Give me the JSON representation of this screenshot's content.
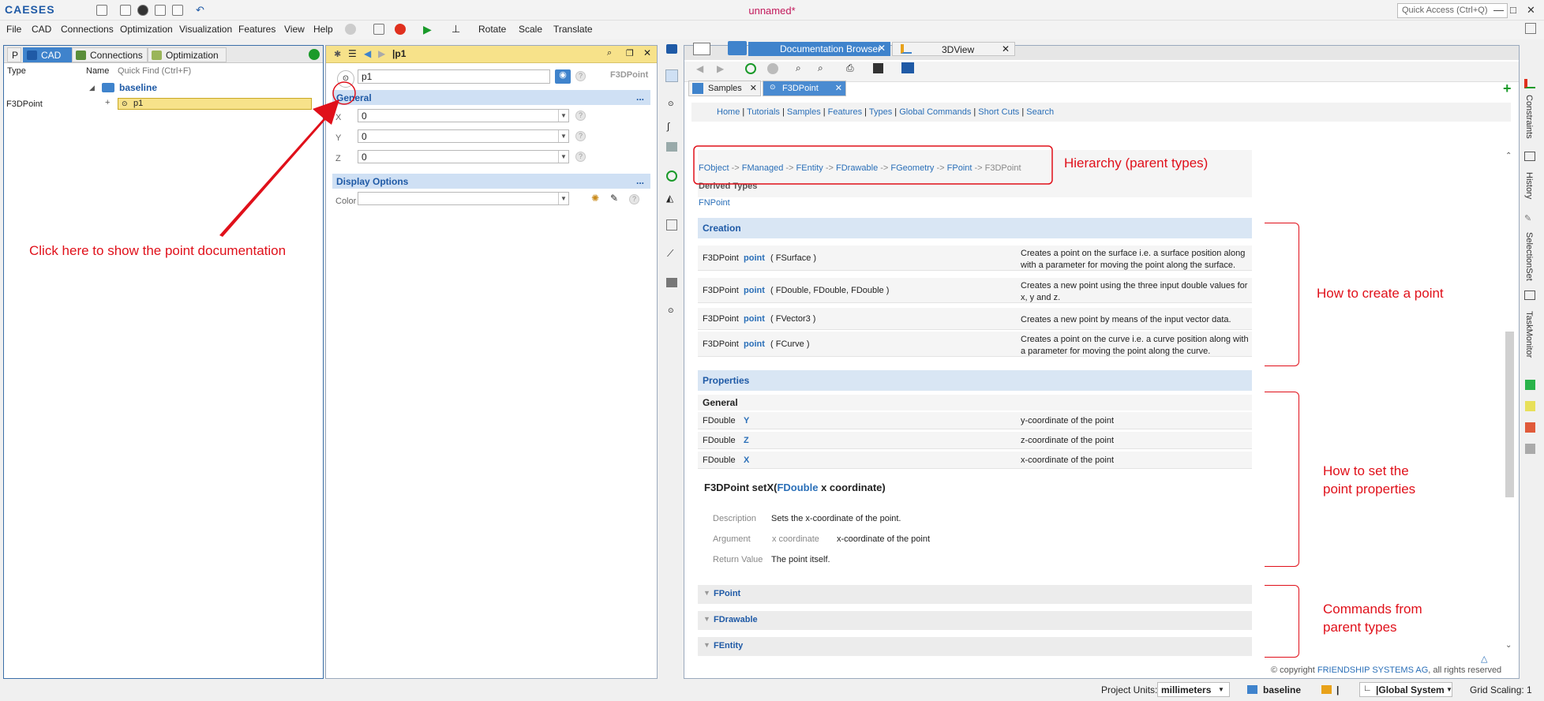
{
  "app": {
    "logo": "CAESES",
    "title": "unnamed*",
    "quick_access_placeholder": "Quick Access (Ctrl+Q)"
  },
  "menu": [
    "File",
    "CAD",
    "Connections",
    "Optimization",
    "Visualization",
    "Features",
    "View",
    "Help"
  ],
  "toolbar_actions": {
    "rotate": "Rotate",
    "scale": "Scale",
    "translate": "Translate"
  },
  "left": {
    "tabs": [
      {
        "label": "P"
      },
      {
        "label": "CAD"
      },
      {
        "label": "Connections"
      },
      {
        "label": "Optimization"
      }
    ],
    "col_type": "Type",
    "col_name": "Name",
    "quick_find": "Quick Find (Ctrl+F)",
    "tree": {
      "group": "baseline",
      "item_type": "F3DPoint",
      "item_name": "p1"
    }
  },
  "mid": {
    "header": "p1",
    "type_label": "F3DPoint",
    "name_value": "p1",
    "general": "General",
    "display": "Display Options",
    "fields": [
      {
        "label": "X",
        "value": "0"
      },
      {
        "label": "Y",
        "value": "0"
      },
      {
        "label": "Z",
        "value": "0"
      }
    ],
    "color_label": "Color",
    "more": "..."
  },
  "right": {
    "top_tabs": [
      {
        "label": "Documentation Browser"
      },
      {
        "label": "3DView"
      }
    ],
    "doc_tabs": [
      {
        "label": "Samples"
      },
      {
        "label": "F3DPoint"
      }
    ],
    "nav": [
      "Home",
      "Tutorials",
      "Samples",
      "Features",
      "Types",
      "Global Commands",
      "Short Cuts",
      "Search"
    ],
    "hierarchy": [
      "FObject",
      "FManaged",
      "FEntity",
      "FDrawable",
      "FGeometry",
      "FPoint"
    ],
    "hierarchy_current": "F3DPoint",
    "arrow": "->",
    "derived_title": "Derived Types",
    "derived": "FNPoint",
    "creation_title": "Creation",
    "creation": [
      {
        "type": "F3DPoint",
        "method": "point",
        "args": "( FSurface )",
        "desc": "Creates a point on the surface i.e. a surface position along with a parameter for moving the point along the surface."
      },
      {
        "type": "F3DPoint",
        "method": "point",
        "args": "( FDouble, FDouble, FDouble )",
        "desc": "Creates a new point using the three input double values for x, y and z."
      },
      {
        "type": "F3DPoint",
        "method": "point",
        "args": "( FVector3 )",
        "desc": "Creates a new point by means of the input vector data."
      },
      {
        "type": "F3DPoint",
        "method": "point",
        "args": "( FCurve )",
        "desc": "Creates a point on the curve i.e. a curve position along with a parameter for moving the point along the curve."
      }
    ],
    "properties_title": "Properties",
    "properties_sub": "General",
    "properties": [
      {
        "type": "FDouble",
        "name": "Y",
        "desc": "y-coordinate of the point"
      },
      {
        "type": "FDouble",
        "name": "Z",
        "desc": "z-coordinate of the point"
      },
      {
        "type": "FDouble",
        "name": "X",
        "desc": "x-coordinate of the point"
      }
    ],
    "setx": {
      "ret": "F3DPoint setX(",
      "argtype": "FDouble",
      "argname": " x coordinate)",
      "rows": [
        {
          "label": "Description",
          "value": "Sets the x-coordinate of the point.",
          "extra": ""
        },
        {
          "label": "Argument",
          "value": "x coordinate",
          "extra": "x-coordinate of the point"
        },
        {
          "label": "Return Value",
          "value": "The point itself.",
          "extra": ""
        }
      ]
    },
    "parents": [
      "FPoint",
      "FDrawable",
      "FEntity"
    ],
    "copyright": "© copyright",
    "copyright_org": "FRIENDSHIP SYSTEMS AG",
    "copyright_tail": ", all rights reserved"
  },
  "side_tabs": [
    "Constraints",
    "History",
    "SelectionSet",
    "TaskMonitor"
  ],
  "annotations": {
    "click": "Click here to show the point documentation",
    "hierarchy": "Hierarchy (parent types)",
    "create": "How to create a point",
    "set": [
      "How to set the",
      "point properties"
    ],
    "commands": [
      "Commands from",
      "parent types"
    ]
  },
  "status": {
    "units_label": "Project Units:",
    "units": "millimeters",
    "baseline": "baseline",
    "sep": "|",
    "system": "|Global System",
    "grid": "Grid Scaling: 1"
  },
  "colors": {
    "accent": "#3f83cc",
    "annot": "#e0101a",
    "highlight": "#f7e28a"
  }
}
